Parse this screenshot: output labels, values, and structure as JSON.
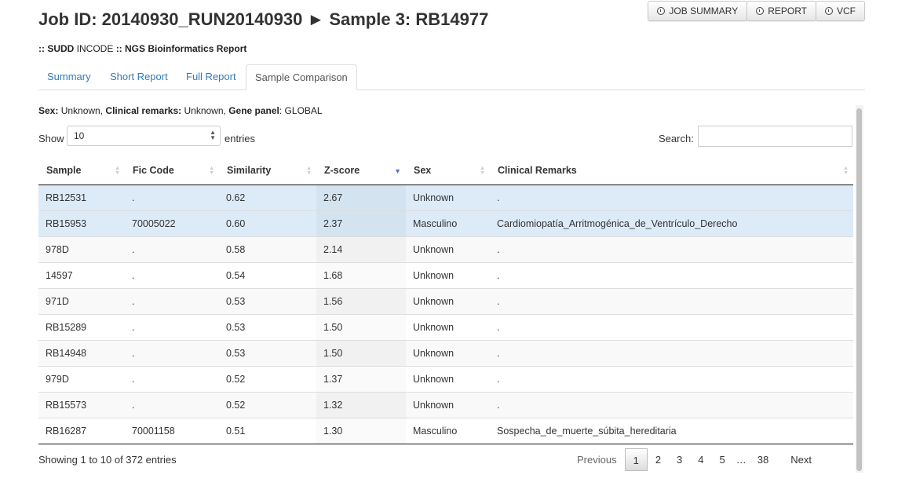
{
  "header": {
    "title": "Job ID: 20140930_RUN20140930 ► Sample 3: RB14977",
    "subtitle_prefix": ":: SUDD",
    "subtitle_mid": "INCODE",
    "subtitle_suffix": ":: NGS Bioinformatics Report",
    "buttons": [
      {
        "label": "JOB SUMMARY",
        "icon": "circle-arrow-icon"
      },
      {
        "label": "REPORT",
        "icon": "circle-arrow-icon"
      },
      {
        "label": "VCF",
        "icon": "circle-arrow-icon"
      }
    ]
  },
  "tabs": [
    {
      "label": "Summary"
    },
    {
      "label": "Short Report"
    },
    {
      "label": "Full Report"
    },
    {
      "label": "Sample Comparison",
      "active": true
    }
  ],
  "meta": {
    "sex_label": "Sex:",
    "sex_value": "Unknown,",
    "remarks_label": "Clinical remarks:",
    "remarks_value": "Unknown,",
    "panel_label": "Gene panel",
    "panel_value": ": GLOBAL"
  },
  "controls": {
    "show_label": "Show",
    "entries_value": "10",
    "entries_label": "entries",
    "search_label": "Search:",
    "search_value": ""
  },
  "table": {
    "columns": [
      "Sample",
      "Fic Code",
      "Similarity",
      "Z-score",
      "Sex",
      "Clinical Remarks"
    ],
    "sorted_column": "Z-score",
    "rows": [
      [
        "RB12531",
        ".",
        "0.62",
        "2.67",
        "Unknown",
        "."
      ],
      [
        "RB15953",
        "70005022",
        "0.60",
        "2.37",
        "Masculino",
        "Cardiomiopatía_Arritmogénica_de_Ventrículo_Derecho"
      ],
      [
        "978D",
        ".",
        "0.58",
        "2.14",
        "Unknown",
        "."
      ],
      [
        "14597",
        ".",
        "0.54",
        "1.68",
        "Unknown",
        "."
      ],
      [
        "971D",
        ".",
        "0.53",
        "1.56",
        "Unknown",
        "."
      ],
      [
        "RB15289",
        ".",
        "0.53",
        "1.50",
        "Unknown",
        "."
      ],
      [
        "RB14948",
        ".",
        "0.53",
        "1.50",
        "Unknown",
        "."
      ],
      [
        "979D",
        ".",
        "0.52",
        "1.37",
        "Unknown",
        "."
      ],
      [
        "RB15573",
        ".",
        "0.52",
        "1.32",
        "Unknown",
        "."
      ],
      [
        "RB16287",
        "70001158",
        "0.51",
        "1.30",
        "Masculino",
        "Sospecha_de_muerte_súbita_hereditaria"
      ]
    ],
    "selected_rows": [
      0,
      1
    ]
  },
  "footer": {
    "info": "Showing 1 to 10 of 372 entries",
    "previous": "Previous",
    "pages": [
      "1",
      "2",
      "3",
      "4",
      "5"
    ],
    "ellipsis": "…",
    "last_page": "38",
    "next": "Next",
    "current_page": "1"
  }
}
